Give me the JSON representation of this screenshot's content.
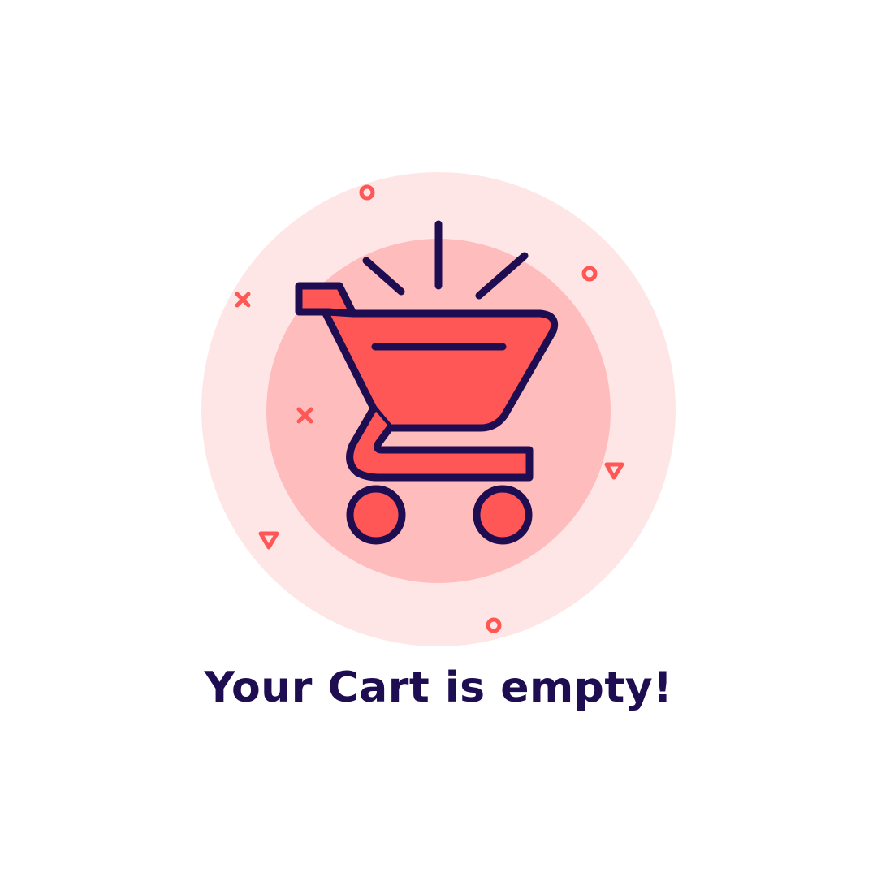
{
  "empty_state": {
    "title": "Your Cart is empty!",
    "icon": "shopping-cart-icon"
  },
  "colors": {
    "outline": "#1f0d52",
    "cart_fill": "#ff5756",
    "outer_circle": "#ffe6e6",
    "inner_circle": "#ffbcbd",
    "accent": "#ff5756",
    "background": "#ffffff"
  }
}
